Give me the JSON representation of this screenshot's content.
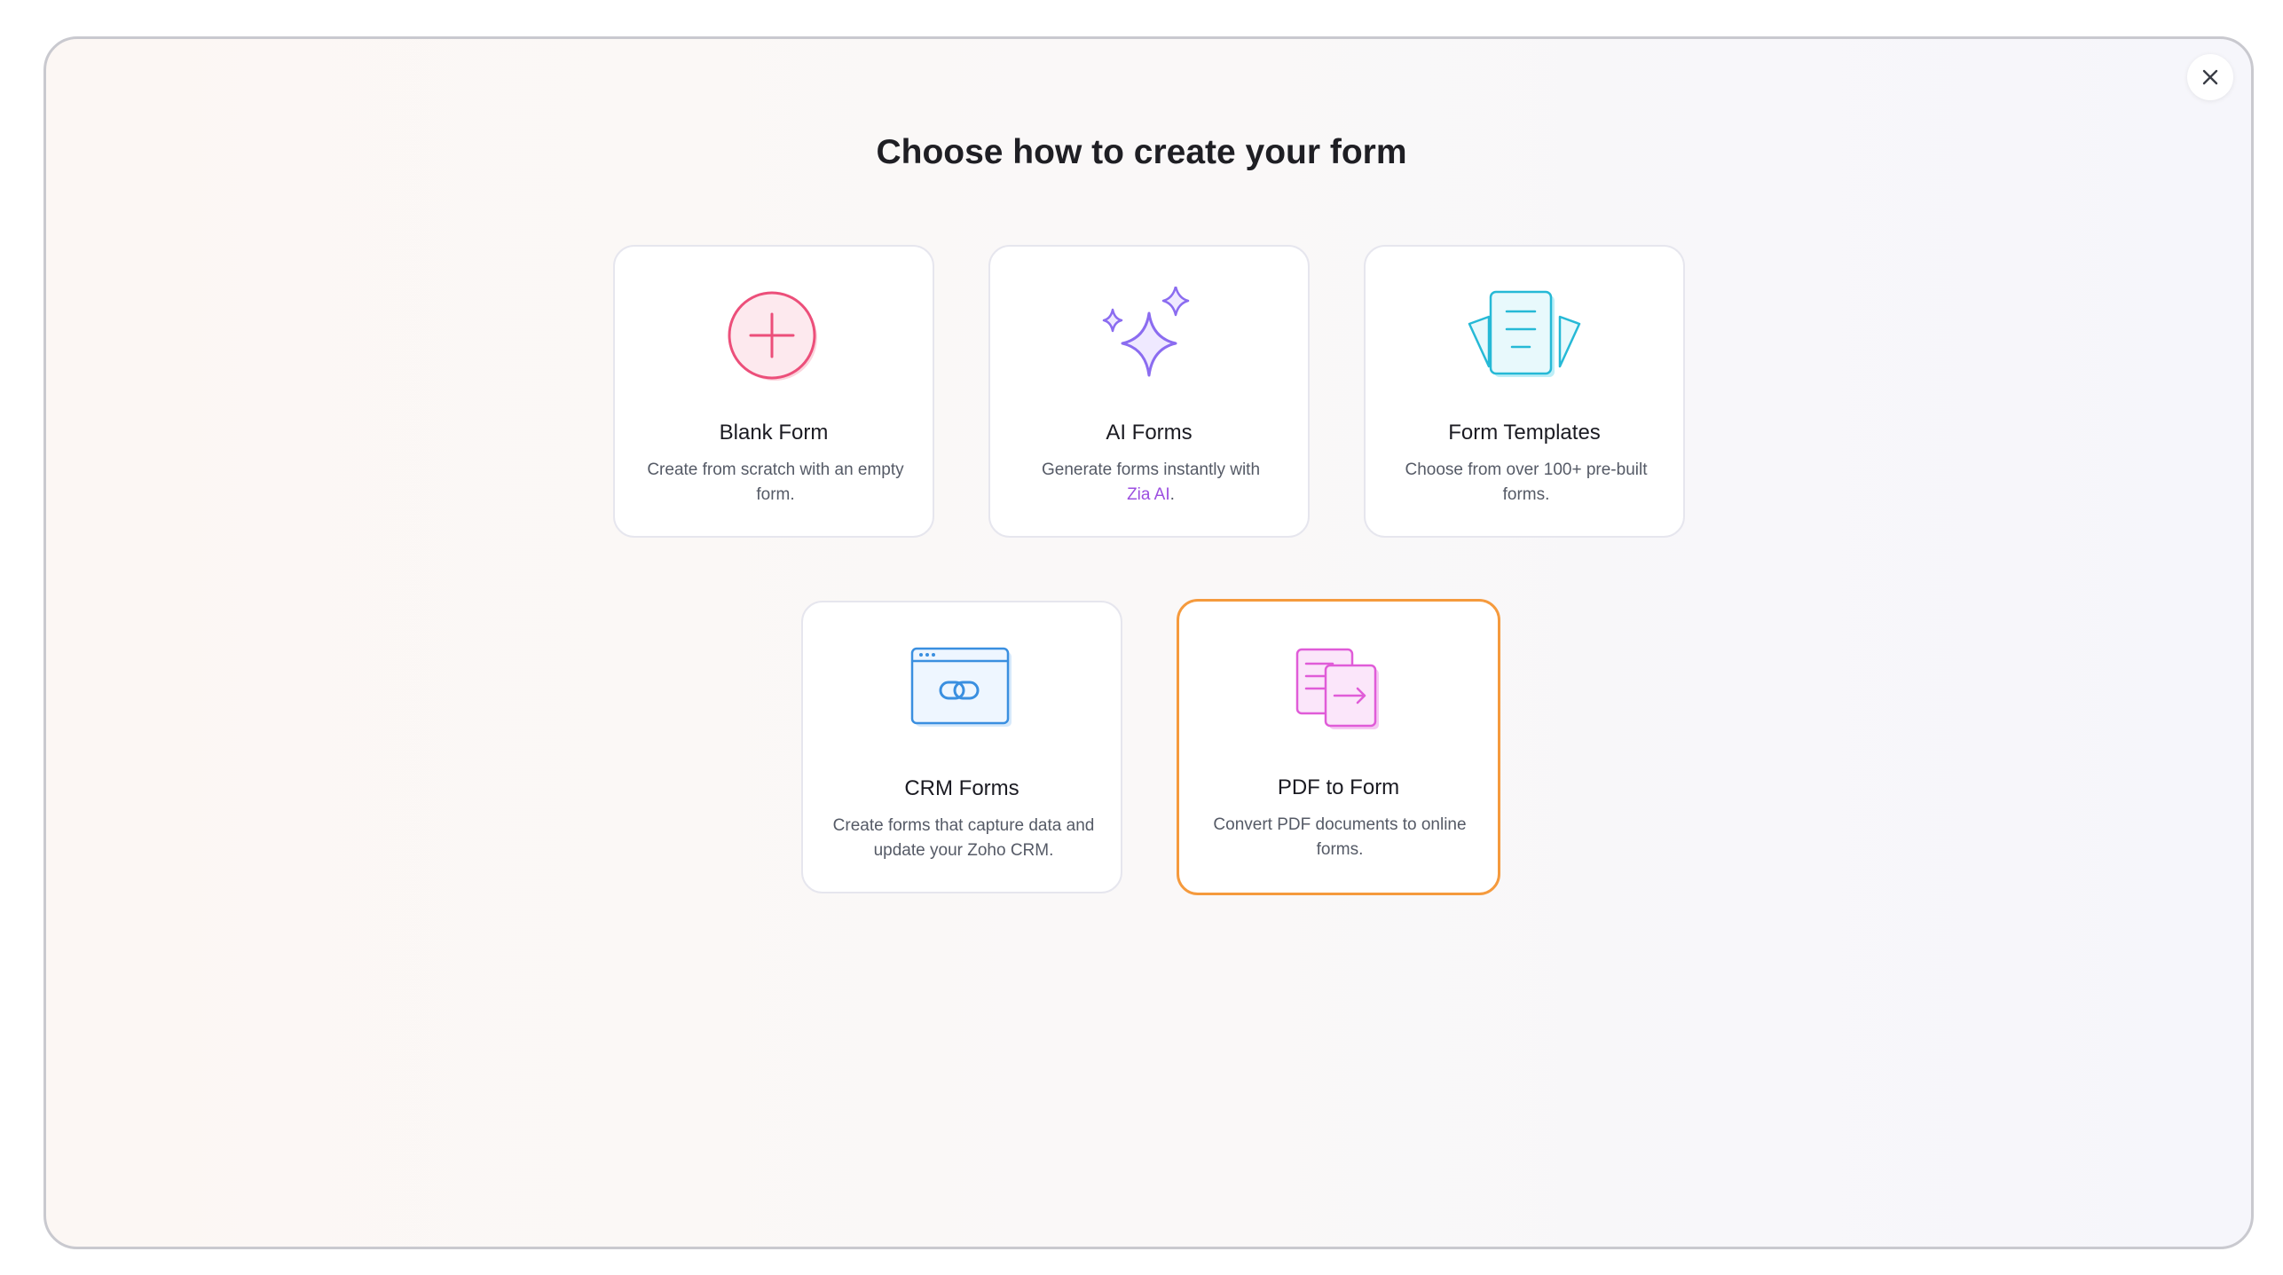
{
  "dialog": {
    "title": "Choose how to create your form",
    "close_icon": "close-icon"
  },
  "options": [
    {
      "id": "blank-form",
      "title": "Blank Form",
      "description": "Create from scratch with an empty form.",
      "icon": "plus-circle-icon",
      "color": "#ec4f7a"
    },
    {
      "id": "ai-forms",
      "title": "AI Forms",
      "description_prefix": "Generate forms instantly with",
      "description_link": "Zia AI",
      "description_suffix": ".",
      "icon": "sparkles-icon",
      "color": "#8b6cf0"
    },
    {
      "id": "form-templates",
      "title": "Form Templates",
      "description": "Choose from over 100+ pre-built forms.",
      "icon": "document-template-icon",
      "color": "#26b9d6"
    },
    {
      "id": "crm-forms",
      "title": "CRM Forms",
      "description": "Create forms that capture data and update your Zoho CRM.",
      "icon": "crm-link-window-icon",
      "color": "#3a8fe0"
    },
    {
      "id": "pdf-to-form",
      "title": "PDF to Form",
      "description": "Convert PDF documents to online forms.",
      "icon": "pdf-convert-icon",
      "color": "#e05cd8",
      "selected": true
    }
  ],
  "colors": {
    "selected_border": "#f59a3d",
    "link": "#9c4fe0"
  }
}
